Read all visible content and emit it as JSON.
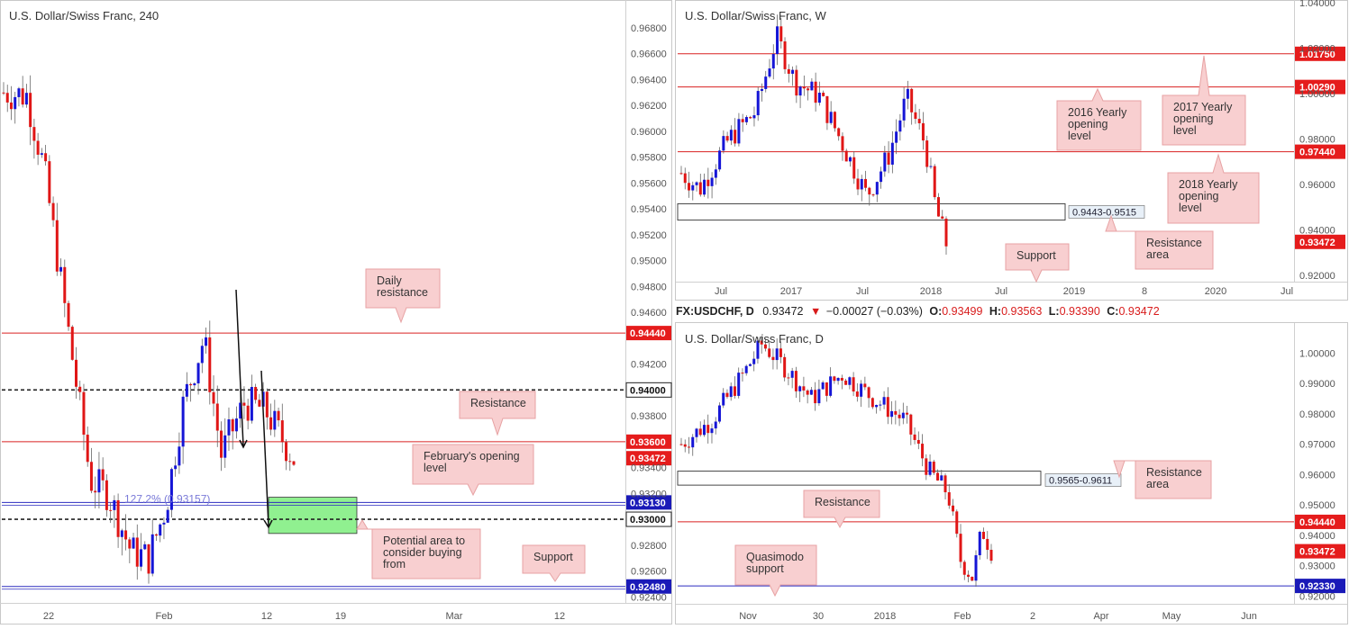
{
  "colors": {
    "up": "#1515d6",
    "down": "#e01616",
    "line_red": "#d92020",
    "line_blue": "#2b2bbf",
    "callout_bg": "#f8cfd0",
    "callout_border": "#e7a2a3",
    "zone_green": "#90f090",
    "price_tag_red": "#e51c1c",
    "price_tag_blue": "#1a1ab8"
  },
  "chart_data": [
    {
      "type": "candlestick",
      "title": "U.S. Dollar/Swiss Franc, 240",
      "ylim": [
        0.9236,
        0.9696
      ],
      "y_ticks": [
        "0.96800",
        "0.96600",
        "0.96400",
        "0.96200",
        "0.96000",
        "0.95800",
        "0.95600",
        "0.95400",
        "0.95200",
        "0.95000",
        "0.94800",
        "0.94600",
        "0.94200",
        "0.93800",
        "0.93400",
        "0.93200",
        "0.92800",
        "0.92600",
        "0.92400"
      ],
      "x_ticks": [
        "22",
        "Feb",
        "12",
        "19",
        "Mar",
        "12"
      ],
      "levels": [
        {
          "label": "0.94440",
          "value": 0.9444,
          "style": "red"
        },
        {
          "label": "0.94000",
          "value": 0.94,
          "style": "dashed"
        },
        {
          "label": "0.93600",
          "value": 0.936,
          "style": "red"
        },
        {
          "label": "0.93130",
          "value": 0.9313,
          "style": "blue"
        },
        {
          "label": "0.93000",
          "value": 0.93,
          "style": "dashed"
        },
        {
          "label": "0.92480",
          "value": 0.9248,
          "style": "blue"
        }
      ],
      "current_price": "0.93472",
      "fib_label": "127.2% (0.93157)",
      "zone": {
        "from": 0.9289,
        "to": 0.9317
      },
      "annotations": [
        {
          "id": "daily_res",
          "text": "Daily resistance"
        },
        {
          "id": "resistance",
          "text": "Resistance"
        },
        {
          "id": "feb_open",
          "text": "February's opening level"
        },
        {
          "id": "buy_area",
          "text": "Potential area to consider buying from"
        },
        {
          "id": "support",
          "text": "Support"
        }
      ]
    },
    {
      "type": "candlestick",
      "title": "U.S. Dollar/Swiss Franc, W",
      "ylim": [
        0.918,
        1.04
      ],
      "y_ticks": [
        "1.04000",
        "1.02000",
        "1.00000",
        "0.98000",
        "0.96000",
        "0.94000",
        "0.92000"
      ],
      "x_ticks": [
        "Jul",
        "2017",
        "Jul",
        "2018",
        "Jul",
        "2019",
        "8",
        "2020",
        "Jul"
      ],
      "levels": [
        {
          "label": "1.01750",
          "value": 1.0175,
          "style": "red"
        },
        {
          "label": "1.00290",
          "value": 1.0029,
          "style": "red"
        },
        {
          "label": "0.97440",
          "value": 0.9744,
          "style": "red"
        }
      ],
      "current_price": "0.93472",
      "zone_label": "0.9443-0.9515",
      "annotations": [
        {
          "id": "y2016",
          "text": "2016 Yearly opening level"
        },
        {
          "id": "y2017",
          "text": "2017 Yearly opening level"
        },
        {
          "id": "y2018",
          "text": "2018 Yearly opening level"
        },
        {
          "id": "res_area",
          "text": "Resistance area"
        },
        {
          "id": "support",
          "text": "Support"
        }
      ]
    },
    {
      "type": "candlestick",
      "title": "U.S. Dollar/Swiss Franc, D",
      "ylim": [
        0.918,
        1.009
      ],
      "y_ticks": [
        "1.00000",
        "0.99000",
        "0.98000",
        "0.97000",
        "0.96000",
        "0.95000",
        "0.94000",
        "0.93000",
        "0.92000"
      ],
      "x_ticks": [
        "Nov",
        "30",
        "2018",
        "Feb",
        "2",
        "Apr",
        "May",
        "Jun"
      ],
      "levels": [
        {
          "label": "0.94440",
          "value": 0.9444,
          "style": "red"
        },
        {
          "label": "0.92330",
          "value": 0.9233,
          "style": "blue"
        }
      ],
      "current_price": "0.93472",
      "zone_label": "0.9565-0.9611",
      "annotations": [
        {
          "id": "res_area",
          "text": "Resistance area"
        },
        {
          "id": "resistance",
          "text": "Resistance"
        },
        {
          "id": "qm",
          "text": "Quasimodo support"
        }
      ]
    }
  ],
  "ticker": {
    "symbol": "FX:USDCHF, D",
    "last": "0.93472",
    "change": "−0.00027 (−0.03%)",
    "o_label": "O:",
    "o": "0.93499",
    "h_label": "H:",
    "h": "0.93563",
    "l_label": "L:",
    "l": "0.93390",
    "c_label": "C:",
    "c": "0.93472"
  }
}
